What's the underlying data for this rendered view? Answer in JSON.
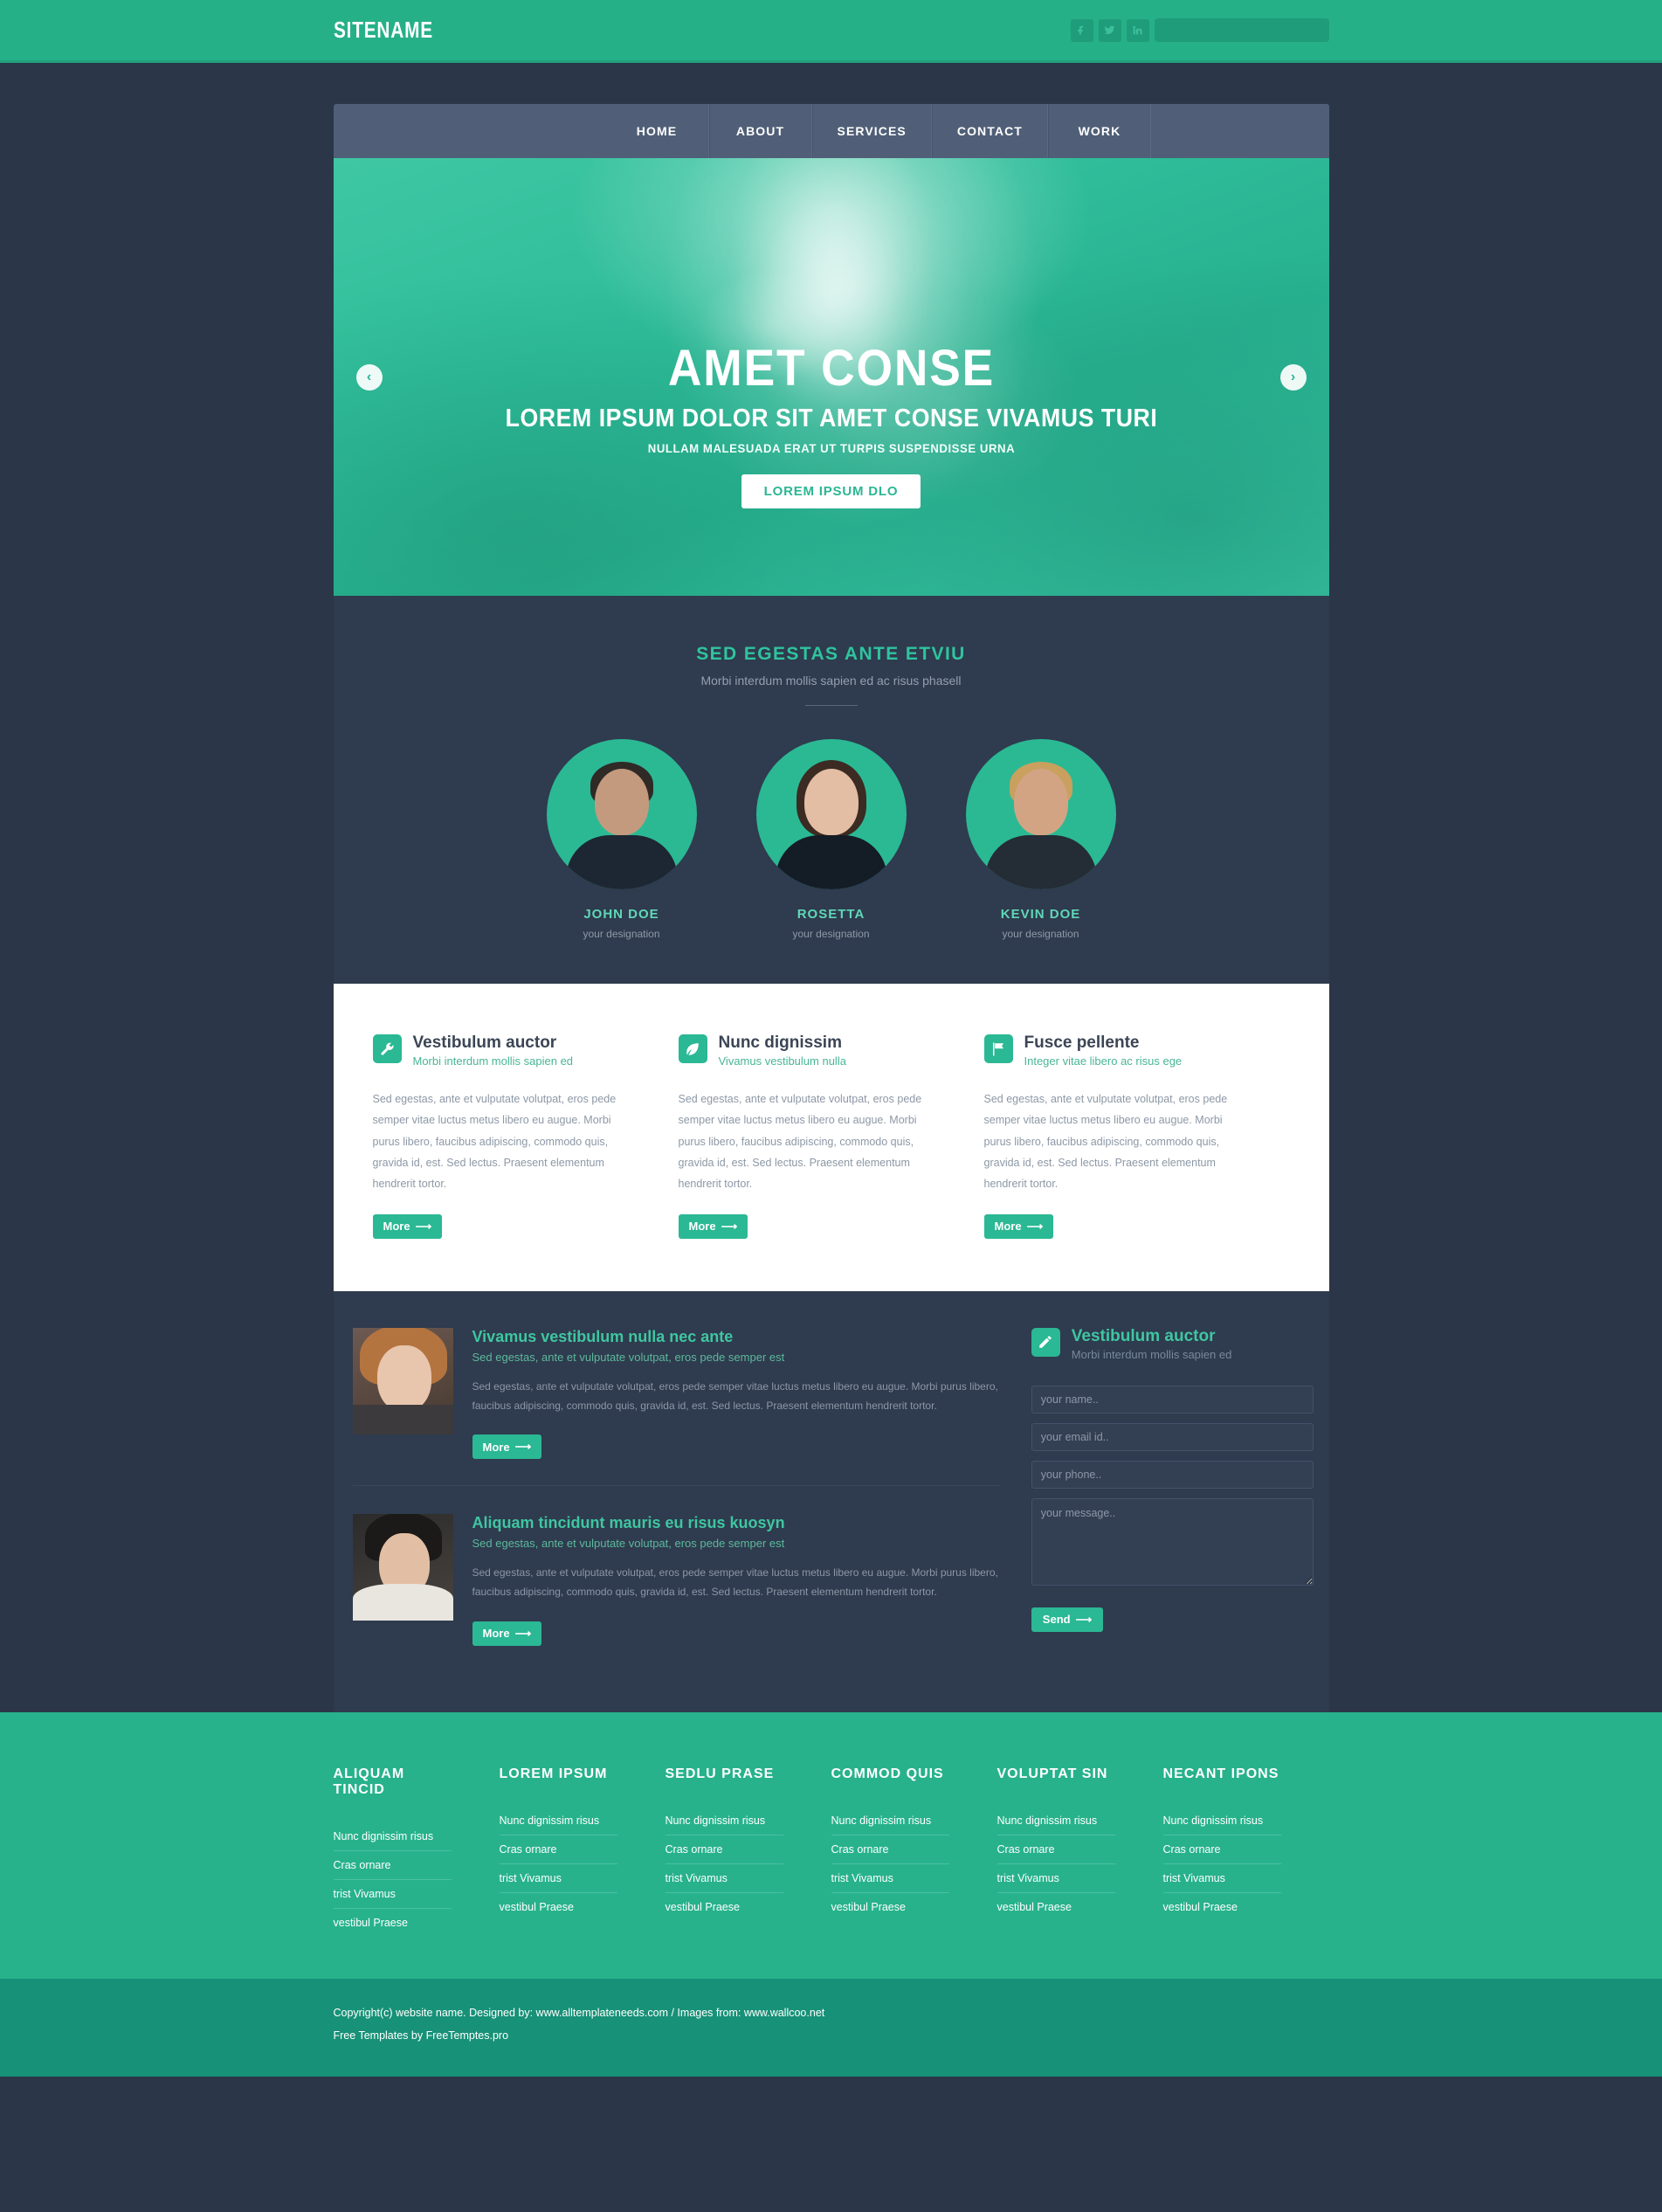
{
  "topbar": {
    "sitename": "SITENAME",
    "social": [
      {
        "name": "facebook-icon",
        "glyph": "f"
      },
      {
        "name": "twitter-icon",
        "glyph": "t"
      },
      {
        "name": "linkedin-icon",
        "glyph": "in"
      }
    ],
    "search_placeholder": ""
  },
  "nav": {
    "items": [
      {
        "label": "HOME"
      },
      {
        "label": "ABOUT"
      },
      {
        "label": "SERVICES"
      },
      {
        "label": "CONTACT"
      },
      {
        "label": "WORK"
      }
    ]
  },
  "hero": {
    "title": "AMET CONSE",
    "subtitle": "LOREM IPSUM DOLOR SIT AMET CONSE VIVAMUS TURI",
    "tagline": "NULLAM MALESUADA ERAT UT TURPIS SUSPENDISSE URNA",
    "button": "LOREM IPSUM DLO",
    "prev": "‹",
    "next": "›"
  },
  "team": {
    "heading": "SED EGESTAS ANTE ETVIU",
    "subheading": "Morbi interdum mollis sapien ed ac risus phasell",
    "members": [
      {
        "name": "JOHN DOE",
        "designation": "your designation"
      },
      {
        "name": "ROSETTA",
        "designation": "your designation"
      },
      {
        "name": "KEVIN DOE",
        "designation": "your designation"
      }
    ]
  },
  "features": {
    "body": "Sed egestas, ante et vulputate volutpat, eros pede semper vitae luctus metus libero eu augue. Morbi purus libero, faucibus adipiscing, commodo quis, gravida id, est. Sed lectus. Praesent elementum hendrerit tortor.",
    "more_label": "More",
    "columns": [
      {
        "icon": "wrench-icon",
        "title": "Vestibulum auctor",
        "subtitle": "Morbi interdum mollis sapien ed"
      },
      {
        "icon": "leaf-icon",
        "title": "Nunc dignissim",
        "subtitle": "Vivamus vestibulum nulla"
      },
      {
        "icon": "flag-icon",
        "title": "Fusce pellente",
        "subtitle": "Integer vitae libero ac risus ege"
      }
    ]
  },
  "blog": {
    "more_label": "More",
    "posts": [
      {
        "title": "Vivamus vestibulum nulla nec ante",
        "subtitle": "Sed egestas, ante et vulputate volutpat, eros pede semper est",
        "body": "Sed egestas, ante et vulputate volutpat, eros pede semper vitae luctus metus libero eu augue. Morbi purus libero, faucibus adipiscing, commodo quis, gravida id, est. Sed lectus. Praesent elementum hendrerit tortor."
      },
      {
        "title": "Aliquam tincidunt mauris eu risus kuosyn",
        "subtitle": "Sed egestas, ante et vulputate volutpat, eros pede semper est",
        "body": "Sed egestas, ante et vulputate volutpat, eros pede semper vitae luctus metus libero eu augue. Morbi purus libero, faucibus adipiscing, commodo quis, gravida id, est. Sed lectus. Praesent elementum hendrerit tortor."
      }
    ]
  },
  "contact": {
    "icon": "pencil-icon",
    "title": "Vestibulum auctor",
    "subtitle": "Morbi interdum mollis sapien ed",
    "name_placeholder": "your name..",
    "email_placeholder": "your email id..",
    "phone_placeholder": "your phone..",
    "message_placeholder": "your message..",
    "send_label": "Send"
  },
  "footer": {
    "columns": [
      {
        "heading": "ALIQUAM TINCID",
        "links": [
          "Nunc dignissim risus",
          "Cras ornare",
          "trist Vivamus",
          "vestibul Praese"
        ]
      },
      {
        "heading": "LOREM IPSUM",
        "links": [
          "Nunc dignissim risus",
          "Cras ornare",
          "trist Vivamus",
          "vestibul Praese"
        ]
      },
      {
        "heading": "SEDLU PRASE",
        "links": [
          "Nunc dignissim risus",
          "Cras ornare",
          "trist Vivamus",
          "vestibul Praese"
        ]
      },
      {
        "heading": "COMMOD QUIS",
        "links": [
          "Nunc dignissim risus",
          "Cras ornare",
          "trist Vivamus",
          "vestibul Praese"
        ]
      },
      {
        "heading": "VOLUPTAT SIN",
        "links": [
          "Nunc dignissim risus",
          "Cras ornare",
          "trist Vivamus",
          "vestibul Praese"
        ]
      },
      {
        "heading": "NECANT IPONS",
        "links": [
          "Nunc dignissim risus",
          "Cras ornare",
          "trist Vivamus",
          "vestibul Praese"
        ]
      }
    ]
  },
  "copyright": {
    "line1": "Copyright(c) website name. Designed by: www.alltemplateneeds.com / Images from: www.wallcoo.net",
    "line2": "Free Templates by FreeTemptes.pro"
  },
  "colors": {
    "brand_green": "#27b28c",
    "accent_green": "#2bb894",
    "dark_navy": "#2b3648",
    "panel_navy": "#2f3b4e",
    "nav_slate": "#505f77"
  }
}
